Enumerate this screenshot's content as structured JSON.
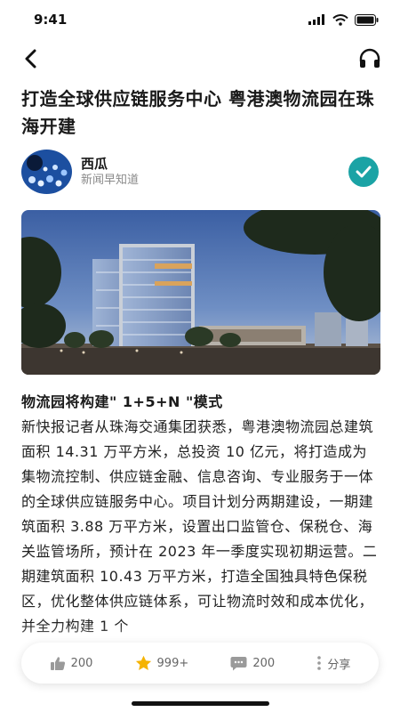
{
  "status_bar": {
    "time": "9:41"
  },
  "article": {
    "title": "打造全球供应链服务中心 粤港澳物流园在珠海开建",
    "author": {
      "name": "西瓜",
      "source": "新闻早知道"
    },
    "section_heading": "物流园将构建\" 1+5+N \"模式",
    "body": "新快报记者从珠海交通集团获悉，粤港澳物流园总建筑面积 14.31 万平方米，总投资 10 亿元，将打造成为集物流控制、供应链金融、信息咨询、专业服务于一体的全球供应链服务中心。项目计划分两期建设，一期建筑面积 3.88 万平方米，设置出口监管仓、保税仓、海关监管场所，预计在 2023 年一季度实现初期运营。二期建筑面积 10.43 万平方米，打造全国独具特色保税区，优化整体供应链体系，可让物流时效和成本优化，并全力构建 1 个"
  },
  "actions": {
    "like_count": "200",
    "favorite_count": "999+",
    "comment_count": "200",
    "share_label": "分享"
  },
  "colors": {
    "verified": "#1ba3a5",
    "favorite": "#f5b301"
  }
}
